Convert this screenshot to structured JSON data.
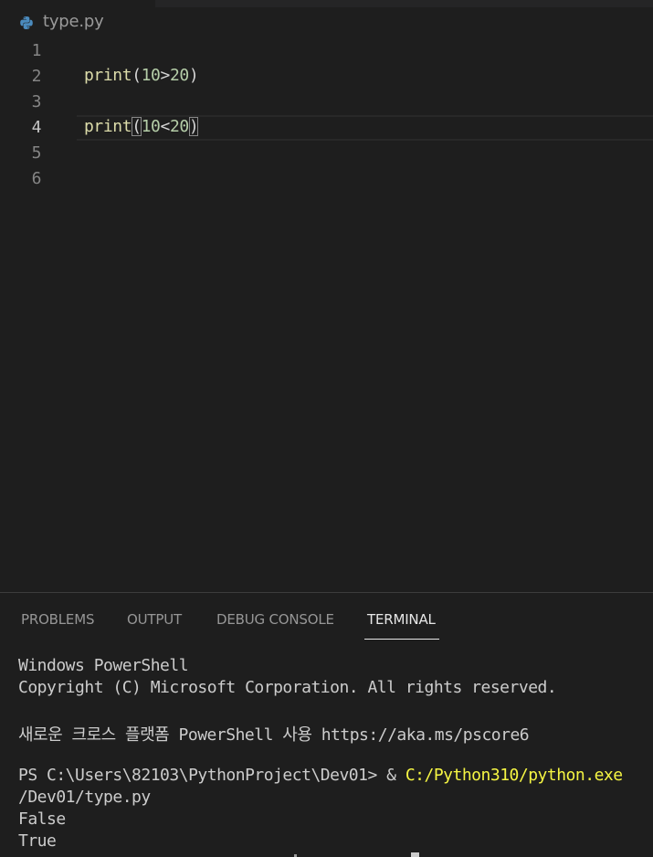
{
  "editor": {
    "file_tab_label": "type.py",
    "file_icon": "python-icon",
    "lines": [
      {
        "number": "1",
        "code": ""
      },
      {
        "number": "2",
        "fn": "print",
        "open": "(",
        "a": "10",
        "op": ">",
        "b": "20",
        "close": ")"
      },
      {
        "number": "3",
        "code": ""
      },
      {
        "number": "4",
        "fn": "print",
        "open": "(",
        "a": "10",
        "op": "<",
        "b": "20",
        "close": ")"
      },
      {
        "number": "5",
        "code": ""
      },
      {
        "number": "6",
        "code": ""
      }
    ],
    "active_line": "4"
  },
  "panel": {
    "tabs": [
      "PROBLEMS",
      "OUTPUT",
      "DEBUG CONSOLE",
      "TERMINAL"
    ],
    "active_tab": "TERMINAL"
  },
  "terminal": {
    "line1": "Windows PowerShell",
    "line2": "Copyright (C) Microsoft Corporation. All rights reserved.",
    "line3": "새로운 크로스 플랫폼 PowerShell 사용 https://aka.ms/pscore6",
    "prompt": "PS C:\\Users\\82103\\PythonProject\\Dev01> & ",
    "command": "C:/Python310/python.exe",
    "line5": "/Dev01/type.py",
    "out1": "False",
    "out2": "True"
  },
  "colors": {
    "background": "#1e1e1e",
    "function": "#dcdcaa",
    "number": "#b5cea8",
    "terminal_highlight": "#f5f543"
  }
}
